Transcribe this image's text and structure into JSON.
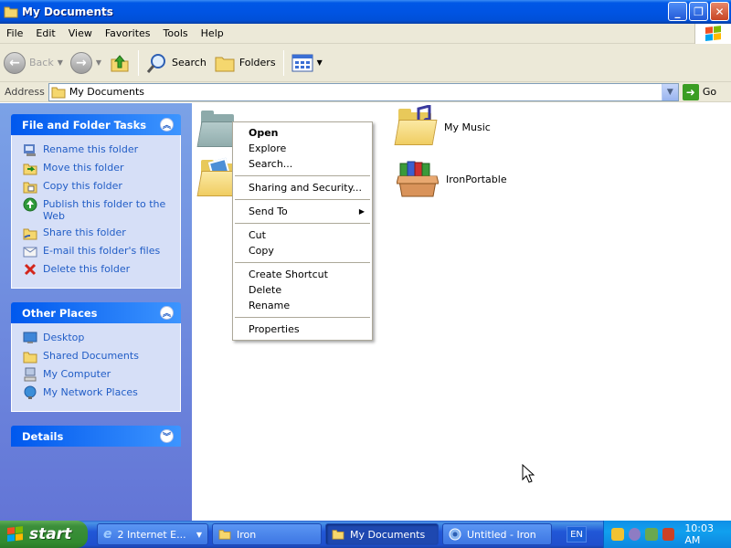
{
  "window": {
    "title": "My Documents"
  },
  "menu": [
    "File",
    "Edit",
    "View",
    "Favorites",
    "Tools",
    "Help"
  ],
  "toolbar": {
    "back_label": "Back",
    "search_label": "Search",
    "folders_label": "Folders"
  },
  "address": {
    "label": "Address",
    "value": "My Documents",
    "go_label": "Go"
  },
  "file_tasks": {
    "title": "File and Folder Tasks",
    "items": [
      "Rename this folder",
      "Move this folder",
      "Copy this folder",
      "Publish this folder to the Web",
      "Share this folder",
      "E-mail this folder's files",
      "Delete this folder"
    ]
  },
  "other_places": {
    "title": "Other Places",
    "items": [
      "Desktop",
      "Shared Documents",
      "My Computer",
      "My Network Places"
    ]
  },
  "details": {
    "title": "Details"
  },
  "files": [
    {
      "label": "My Music"
    },
    {
      "label": "IronPortable"
    }
  ],
  "context_menu": {
    "items": [
      "Open",
      "Explore",
      "Search...",
      "Sharing and Security...",
      "Send To",
      "Cut",
      "Copy",
      "Create Shortcut",
      "Delete",
      "Rename",
      "Properties"
    ]
  },
  "taskbar": {
    "start_label": "start",
    "buttons": [
      "2 Internet E...",
      "Iron",
      "My Documents",
      "Untitled - Iron"
    ],
    "language": "EN",
    "clock": "10:03 AM"
  },
  "colors": {
    "title_bar": "#0054e3",
    "task_pane": "#7ba2e7",
    "link_blue": "#215dc6",
    "start_green": "#3c8f3b"
  }
}
